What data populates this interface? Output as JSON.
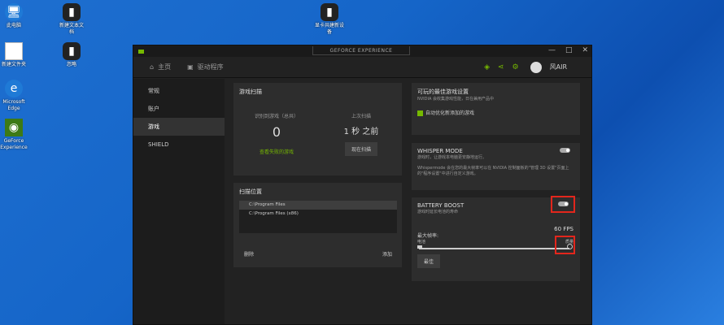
{
  "desktop": {
    "icons": [
      {
        "name": "此电脑",
        "glyph": "🖥"
      },
      {
        "name": "新建文本文\n档",
        "glyph": "▮"
      },
      {
        "name": "新建文件夹",
        "glyph": "🗀"
      },
      {
        "name": "忽略",
        "glyph": "▮"
      },
      {
        "name": "Microsoft\nEdge",
        "glyph": "e"
      },
      {
        "name": "GeForce\nExperience",
        "glyph": "◉"
      },
      {
        "name": "显卡共建新设\n备",
        "glyph": "▮"
      }
    ]
  },
  "window": {
    "brand": "GEFORCE EXPERIENCE",
    "controls": [
      "—",
      "□",
      "✕"
    ],
    "nav": {
      "home": "主页",
      "drivers": "驱动程序",
      "username": "风AIR"
    },
    "sidebar": [
      "常规",
      "账户",
      "游戏",
      "SHIELD"
    ],
    "scan": {
      "title": "游戏扫描",
      "found_caption": "识别到游戏（总共）",
      "found_value": "0",
      "last_caption": "上次扫描",
      "last_value": "1 秒 之前",
      "view_link": "查看失败的游戏",
      "scan_button": "现在扫描"
    },
    "location": {
      "title": "扫描位置",
      "items": [
        "C:\\Program Files",
        "C:\\Program Files (x86)"
      ],
      "remove": "删除",
      "add": "添加"
    },
    "optimal": {
      "title": "可玩的最佳游戏设置",
      "desc": "NVIDIA 会收集游戏性能，日在兼用产品中",
      "checkbox_label": "自动优化新添加的游戏"
    },
    "whisper": {
      "title": "WHISPER MODE",
      "desc1": "游戏时，让游戏本电脑更安静地运行。",
      "desc2": "Whispermode 会在您的最大帧率可以在 NVIDIA 控制面板的\"管理 3D 设置\"页面上的\"程序设置\"中进行自定义游戏。"
    },
    "battery": {
      "title": "BATTERY BOOST",
      "desc": "游戏时延长电池的寿命",
      "fps": "60 FPS",
      "max_fps_label": "最大帧率:",
      "left_label": "电池",
      "right_label": "质量",
      "fps_level_fraction": 1.0,
      "reset_button": "最佳"
    }
  }
}
